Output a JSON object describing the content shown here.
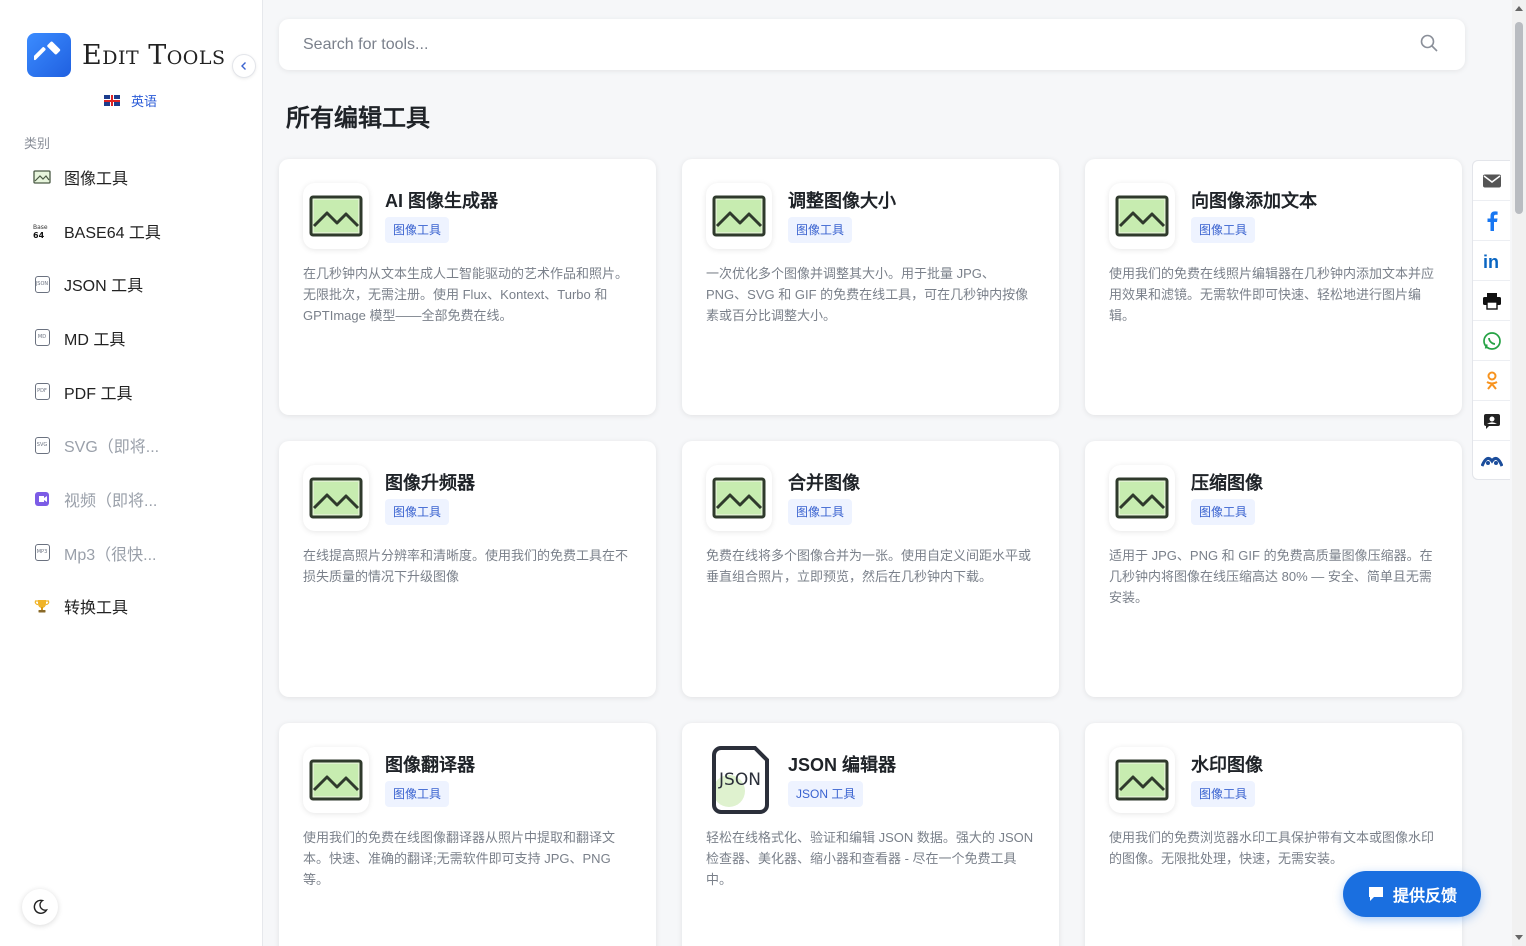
{
  "brand": {
    "name": "Edit Tools",
    "logo_icon": "hammer-icon"
  },
  "language": {
    "label": "英语",
    "flag": "uk-flag-icon"
  },
  "sidebar": {
    "section_title": "类别",
    "items": [
      {
        "label": "图像工具",
        "icon": "image-icon",
        "dim": false
      },
      {
        "label": "BASE64 工具",
        "icon": "base64-icon",
        "dim": false
      },
      {
        "label": "JSON 工具",
        "icon": "json-file-icon",
        "dim": false
      },
      {
        "label": "MD 工具",
        "icon": "md-file-icon",
        "dim": false
      },
      {
        "label": "PDF 工具",
        "icon": "pdf-file-icon",
        "dim": false
      },
      {
        "label": "SVG（即将...",
        "icon": "svg-file-icon",
        "dim": true
      },
      {
        "label": "视频（即将...",
        "icon": "video-icon",
        "dim": true
      },
      {
        "label": "Mp3（很快...",
        "icon": "mp3-file-icon",
        "dim": true
      },
      {
        "label": "转换工具",
        "icon": "trophy-icon",
        "dim": false
      }
    ]
  },
  "search": {
    "placeholder": "Search for tools..."
  },
  "main": {
    "title": "所有编辑工具",
    "cards": [
      {
        "title": "AI 图像生成器",
        "tag": "图像工具",
        "icon": "image-icon",
        "desc": "在几秒钟内从文本生成人工智能驱动的艺术作品和照片。无限批次，无需注册。使用 Flux、Kontext、Turbo 和 GPTImage 模型——全部免费在线。"
      },
      {
        "title": "调整图像大小",
        "tag": "图像工具",
        "icon": "image-icon",
        "desc": "一次优化多个图像并调整其大小。用于批量 JPG、PNG、SVG 和 GIF 的免费在线工具，可在几秒钟内按像素或百分比调整大小。"
      },
      {
        "title": "向图像添加文本",
        "tag": "图像工具",
        "icon": "image-icon",
        "desc": "使用我们的免费在线照片编辑器在几秒钟内添加文本并应用效果和滤镜。无需软件即可快速、轻松地进行图片编辑。"
      },
      {
        "title": "图像升频器",
        "tag": "图像工具",
        "icon": "image-icon",
        "desc": "在线提高照片分辨率和清晰度。使用我们的免费工具在不损失质量的情况下升级图像"
      },
      {
        "title": "合并图像",
        "tag": "图像工具",
        "icon": "image-icon",
        "desc": "免费在线将多个图像合并为一张。使用自定义间距水平或垂直组合照片，立即预览，然后在几秒钟内下载。"
      },
      {
        "title": "压缩图像",
        "tag": "图像工具",
        "icon": "image-icon",
        "desc": "适用于 JPG、PNG 和 GIF 的免费高质量图像压缩器。在几秒钟内将图像在线压缩高达 80% — 安全、简单且无需安装。"
      },
      {
        "title": "图像翻译器",
        "tag": "图像工具",
        "icon": "image-icon",
        "desc": "使用我们的免费在线图像翻译器从照片中提取和翻译文本。快速、准确的翻译;无需软件即可支持 JPG、PNG 等。"
      },
      {
        "title": "JSON 编辑器",
        "tag": "JSON 工具",
        "icon": "json-icon",
        "json_badge": "JSON",
        "desc": "轻松在线格式化、验证和编辑 JSON 数据。强大的 JSON 检查器、美化器、缩小器和查看器 - 尽在一个免费工具中。"
      },
      {
        "title": "水印图像",
        "tag": "图像工具",
        "icon": "image-icon",
        "desc": "使用我们的免费浏览器水印工具保护带有文本或图像水印的图像。无限批处理，快速，无需安装。"
      }
    ]
  },
  "share": [
    "mail-icon",
    "facebook-icon",
    "linkedin-icon",
    "print-icon",
    "whatsapp-icon",
    "odnoklassniki-icon",
    "vk-icon",
    "livejournal-icon"
  ],
  "feedback": {
    "label": "提供反馈",
    "icon": "chat-icon"
  },
  "colors": {
    "accent": "#1a6fe0",
    "tag_bg": "#eef3ff",
    "tag_text": "#3a63d0"
  }
}
